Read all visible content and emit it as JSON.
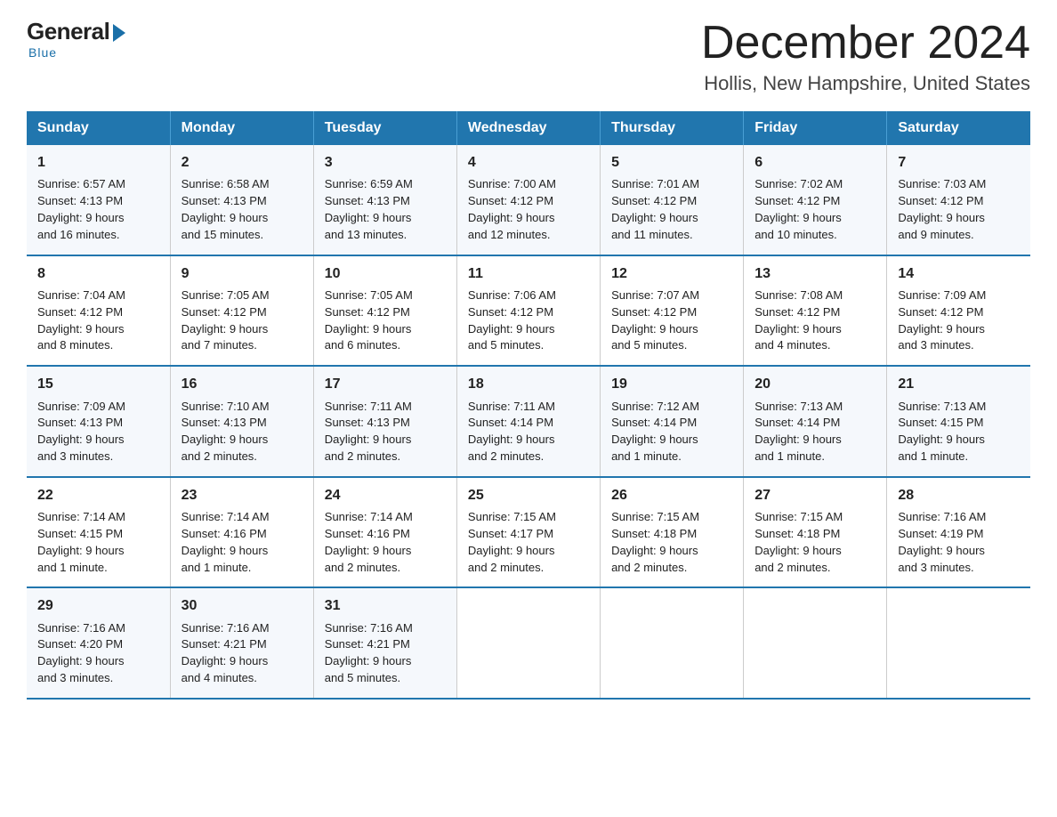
{
  "logo": {
    "general": "General",
    "blue": "Blue",
    "tagline": "Blue"
  },
  "header": {
    "month_title": "December 2024",
    "location": "Hollis, New Hampshire, United States"
  },
  "days_of_week": [
    "Sunday",
    "Monday",
    "Tuesday",
    "Wednesday",
    "Thursday",
    "Friday",
    "Saturday"
  ],
  "weeks": [
    [
      {
        "day": "1",
        "sunrise": "6:57 AM",
        "sunset": "4:13 PM",
        "daylight": "9 hours and 16 minutes."
      },
      {
        "day": "2",
        "sunrise": "6:58 AM",
        "sunset": "4:13 PM",
        "daylight": "9 hours and 15 minutes."
      },
      {
        "day": "3",
        "sunrise": "6:59 AM",
        "sunset": "4:13 PM",
        "daylight": "9 hours and 13 minutes."
      },
      {
        "day": "4",
        "sunrise": "7:00 AM",
        "sunset": "4:12 PM",
        "daylight": "9 hours and 12 minutes."
      },
      {
        "day": "5",
        "sunrise": "7:01 AM",
        "sunset": "4:12 PM",
        "daylight": "9 hours and 11 minutes."
      },
      {
        "day": "6",
        "sunrise": "7:02 AM",
        "sunset": "4:12 PM",
        "daylight": "9 hours and 10 minutes."
      },
      {
        "day": "7",
        "sunrise": "7:03 AM",
        "sunset": "4:12 PM",
        "daylight": "9 hours and 9 minutes."
      }
    ],
    [
      {
        "day": "8",
        "sunrise": "7:04 AM",
        "sunset": "4:12 PM",
        "daylight": "9 hours and 8 minutes."
      },
      {
        "day": "9",
        "sunrise": "7:05 AM",
        "sunset": "4:12 PM",
        "daylight": "9 hours and 7 minutes."
      },
      {
        "day": "10",
        "sunrise": "7:05 AM",
        "sunset": "4:12 PM",
        "daylight": "9 hours and 6 minutes."
      },
      {
        "day": "11",
        "sunrise": "7:06 AM",
        "sunset": "4:12 PM",
        "daylight": "9 hours and 5 minutes."
      },
      {
        "day": "12",
        "sunrise": "7:07 AM",
        "sunset": "4:12 PM",
        "daylight": "9 hours and 5 minutes."
      },
      {
        "day": "13",
        "sunrise": "7:08 AM",
        "sunset": "4:12 PM",
        "daylight": "9 hours and 4 minutes."
      },
      {
        "day": "14",
        "sunrise": "7:09 AM",
        "sunset": "4:12 PM",
        "daylight": "9 hours and 3 minutes."
      }
    ],
    [
      {
        "day": "15",
        "sunrise": "7:09 AM",
        "sunset": "4:13 PM",
        "daylight": "9 hours and 3 minutes."
      },
      {
        "day": "16",
        "sunrise": "7:10 AM",
        "sunset": "4:13 PM",
        "daylight": "9 hours and 2 minutes."
      },
      {
        "day": "17",
        "sunrise": "7:11 AM",
        "sunset": "4:13 PM",
        "daylight": "9 hours and 2 minutes."
      },
      {
        "day": "18",
        "sunrise": "7:11 AM",
        "sunset": "4:14 PM",
        "daylight": "9 hours and 2 minutes."
      },
      {
        "day": "19",
        "sunrise": "7:12 AM",
        "sunset": "4:14 PM",
        "daylight": "9 hours and 1 minute."
      },
      {
        "day": "20",
        "sunrise": "7:13 AM",
        "sunset": "4:14 PM",
        "daylight": "9 hours and 1 minute."
      },
      {
        "day": "21",
        "sunrise": "7:13 AM",
        "sunset": "4:15 PM",
        "daylight": "9 hours and 1 minute."
      }
    ],
    [
      {
        "day": "22",
        "sunrise": "7:14 AM",
        "sunset": "4:15 PM",
        "daylight": "9 hours and 1 minute."
      },
      {
        "day": "23",
        "sunrise": "7:14 AM",
        "sunset": "4:16 PM",
        "daylight": "9 hours and 1 minute."
      },
      {
        "day": "24",
        "sunrise": "7:14 AM",
        "sunset": "4:16 PM",
        "daylight": "9 hours and 2 minutes."
      },
      {
        "day": "25",
        "sunrise": "7:15 AM",
        "sunset": "4:17 PM",
        "daylight": "9 hours and 2 minutes."
      },
      {
        "day": "26",
        "sunrise": "7:15 AM",
        "sunset": "4:18 PM",
        "daylight": "9 hours and 2 minutes."
      },
      {
        "day": "27",
        "sunrise": "7:15 AM",
        "sunset": "4:18 PM",
        "daylight": "9 hours and 2 minutes."
      },
      {
        "day": "28",
        "sunrise": "7:16 AM",
        "sunset": "4:19 PM",
        "daylight": "9 hours and 3 minutes."
      }
    ],
    [
      {
        "day": "29",
        "sunrise": "7:16 AM",
        "sunset": "4:20 PM",
        "daylight": "9 hours and 3 minutes."
      },
      {
        "day": "30",
        "sunrise": "7:16 AM",
        "sunset": "4:21 PM",
        "daylight": "9 hours and 4 minutes."
      },
      {
        "day": "31",
        "sunrise": "7:16 AM",
        "sunset": "4:21 PM",
        "daylight": "9 hours and 5 minutes."
      },
      null,
      null,
      null,
      null
    ]
  ],
  "labels": {
    "sunrise": "Sunrise:",
    "sunset": "Sunset:",
    "daylight": "Daylight:"
  }
}
